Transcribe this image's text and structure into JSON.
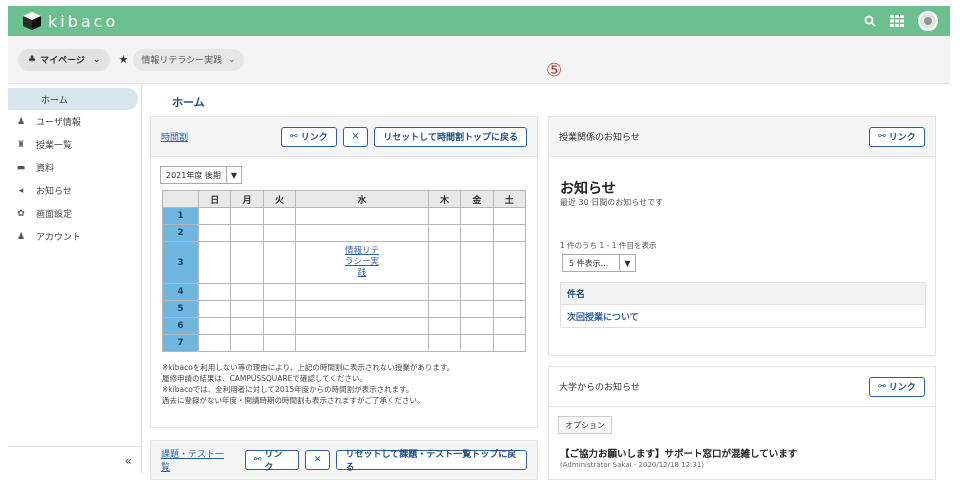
{
  "app": {
    "name": "kibaco"
  },
  "breadcrumb": {
    "mypage": "マイページ",
    "course": "情報リテラシー実践"
  },
  "marker": "⑤",
  "sidebar": {
    "home": "ホーム",
    "items": [
      {
        "label": "ユーザ情報",
        "icon": "user-icon"
      },
      {
        "label": "授業一覧",
        "icon": "class-icon"
      },
      {
        "label": "資料",
        "icon": "folder-icon"
      },
      {
        "label": "お知らせ",
        "icon": "megaphone-icon"
      },
      {
        "label": "画面設定",
        "icon": "gear-icon"
      },
      {
        "label": "アカウント",
        "icon": "account-icon"
      }
    ],
    "collapse": "«"
  },
  "main": {
    "title": "ホーム",
    "timetable": {
      "heading": "時間割",
      "link_btn": "リンク",
      "reset_btn": "リセットして時間割トップに戻る",
      "term": "2021年度 後期",
      "days": [
        "日",
        "月",
        "火",
        "水",
        "木",
        "金",
        "土"
      ],
      "periods": [
        "1",
        "2",
        "3",
        "4",
        "5",
        "6",
        "7"
      ],
      "course": "情報リテラシー実践",
      "course_lines": [
        "情報リテ",
        "ラシー実",
        "践"
      ],
      "notes": [
        "※kibacoを利用しない等の理由により、上記の時間割に表示されない授業があります。",
        "履修申請の結果は、CAMPUSSQUAREで確認してください。",
        "※kibacoでは、全利用者に対して2015年度からの時間割が表示されます。",
        "過去に登録がない年度・開講時期の時間割も表示されますがご了承ください。"
      ]
    },
    "tasks": {
      "heading": "課題・テスト一覧",
      "link_btn": "リンク",
      "reset_btn": "リセットして課題・テスト一覧トップに戻る"
    }
  },
  "notices": {
    "heading": "授業関係のお知らせ",
    "link_btn": "リンク",
    "title": "お知らせ",
    "subtitle": "最近 30 日間のお知らせです",
    "count": "1 件のうち 1 - 1 件目を表示",
    "per_page": "5 件表示...",
    "column": "件名",
    "row": "次回授業について"
  },
  "univ": {
    "heading": "大学からのお知らせ",
    "link_btn": "リンク",
    "option": "オプション",
    "announce": "【ご協力お願いします】サポート窓口が混雑しています",
    "meta": "(Administrator Sakai - 2020/12/18 12:31)"
  }
}
